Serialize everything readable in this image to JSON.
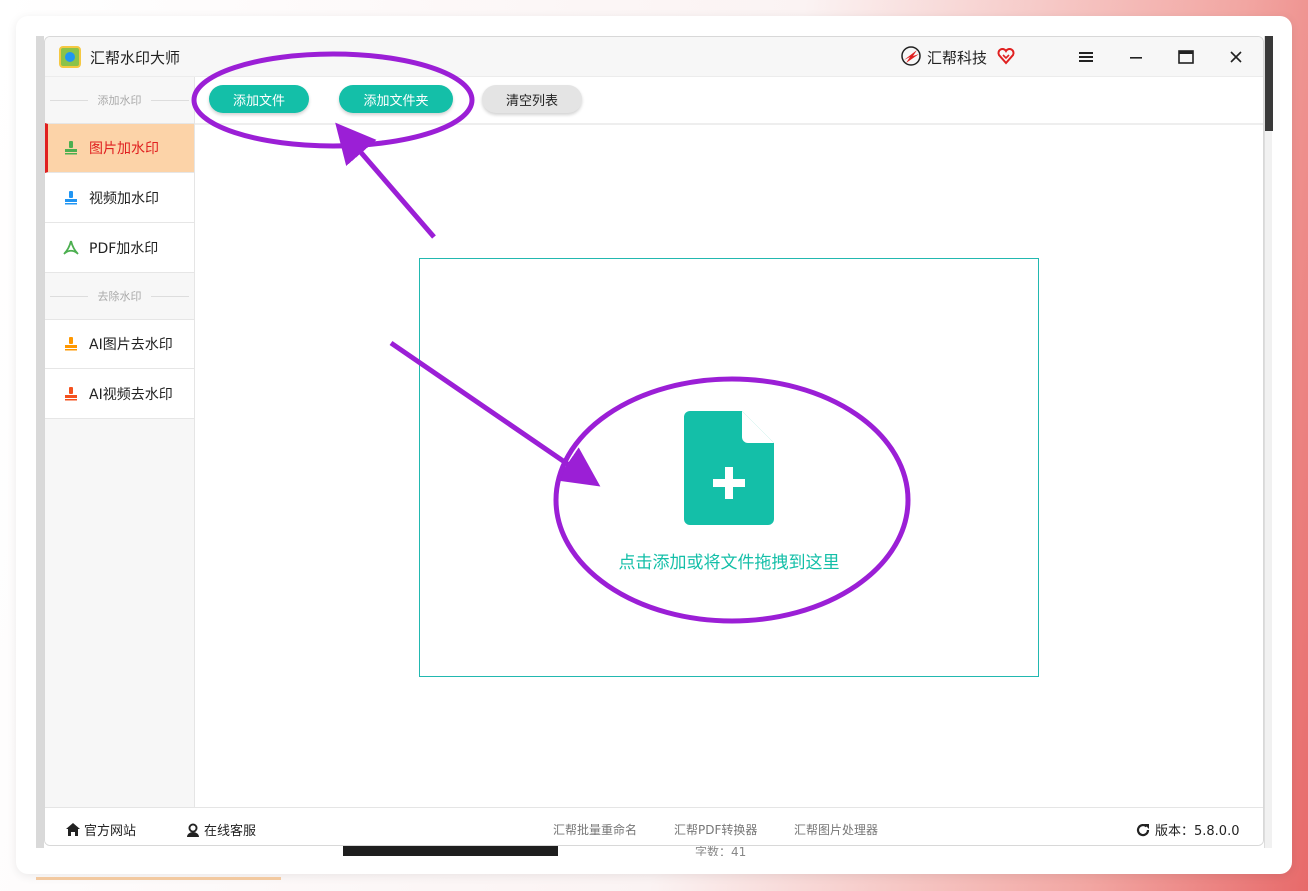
{
  "app": {
    "title": "汇帮水印大师",
    "brand": "汇帮科技"
  },
  "sidebar": {
    "section_add": "添加水印",
    "section_remove": "去除水印",
    "items": [
      {
        "label": "图片加水印",
        "icon": "image-stamp-icon",
        "active": true
      },
      {
        "label": "视频加水印",
        "icon": "video-stamp-icon",
        "active": false
      },
      {
        "label": "PDF加水印",
        "icon": "pdf-icon",
        "active": false
      },
      {
        "label": "AI图片去水印",
        "icon": "ai-image-stamp-icon",
        "active": false
      },
      {
        "label": "AI视频去水印",
        "icon": "ai-video-stamp-icon",
        "active": false
      }
    ]
  },
  "toolbar": {
    "add_file": "添加文件",
    "add_folder": "添加文件夹",
    "clear_list": "清空列表"
  },
  "drop_zone": {
    "hint": "点击添加或将文件拖拽到这里",
    "icon": "file-add-icon"
  },
  "footer": {
    "site": "官方网站",
    "service": "在线客服",
    "tools": [
      "汇帮批量重命名",
      "汇帮PDF转换器",
      "汇帮图片处理器"
    ],
    "version": "版本：5.8.0.0"
  },
  "background": {
    "partial_text": "字数：41"
  },
  "colors": {
    "accent": "#14bfa8",
    "active_bg": "#fcd3a8",
    "active_text": "#e02020",
    "annotation": "#9b1fd6"
  }
}
